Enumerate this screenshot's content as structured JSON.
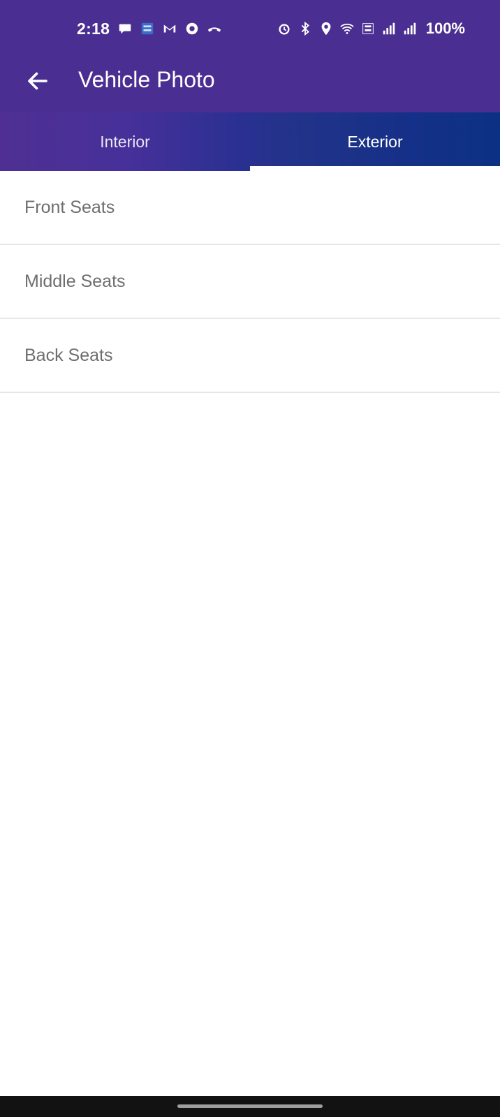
{
  "status_bar": {
    "time": "2:18",
    "battery": "100%",
    "left_icons": [
      "chat-icon",
      "app-icon",
      "gmail-icon",
      "circle-icon",
      "missed-call-icon"
    ],
    "right_icons": [
      "alarm-icon",
      "bluetooth-icon",
      "location-icon",
      "wifi-icon",
      "volte-icon",
      "signal-icon",
      "signal-icon"
    ]
  },
  "app_bar": {
    "title": "Vehicle Photo",
    "back_icon": "back-arrow-icon"
  },
  "tabs": [
    {
      "label": "Interior",
      "active": false
    },
    {
      "label": "Exterior",
      "active": true
    }
  ],
  "list": {
    "items": [
      {
        "label": "Front Seats"
      },
      {
        "label": "Middle Seats"
      },
      {
        "label": "Back Seats"
      }
    ]
  },
  "colors": {
    "header_bg": "#4b2e91",
    "tab_gradient_start": "#4f2f93",
    "tab_gradient_end": "#0b3184",
    "list_text": "#6e6e6e",
    "divider": "#e6e6e6"
  }
}
